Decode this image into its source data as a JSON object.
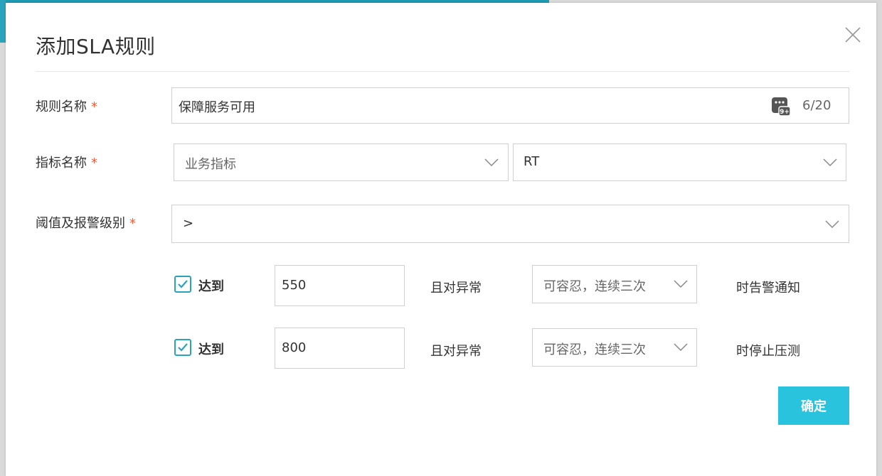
{
  "dialog": {
    "title": "添加SLA规则",
    "confirm_label": "确定"
  },
  "rule_name": {
    "label": "规则名称",
    "required_mark": "*",
    "value": "保障服务可用",
    "counter": "6/20",
    "counter_icon": "autofill-9plus-icon"
  },
  "metric_name": {
    "label": "指标名称",
    "required_mark": "*",
    "category_placeholder": "业务指标",
    "metric_value": "RT"
  },
  "threshold": {
    "label": "阈值及报警级别",
    "required_mark": "*",
    "operator": ">"
  },
  "conditions": [
    {
      "checked": true,
      "reach_label": "达到",
      "value": "550",
      "and_label": "且对异常",
      "tolerance": "可容忍，连续三次",
      "action_label": "时告警通知"
    },
    {
      "checked": true,
      "reach_label": "达到",
      "value": "800",
      "and_label": "且对异常",
      "tolerance": "可容忍，连续三次",
      "action_label": "时停止压测"
    }
  ],
  "colors": {
    "accent": "#2aa3bd",
    "button": "#29c3dd",
    "required": "#f25c3b"
  }
}
